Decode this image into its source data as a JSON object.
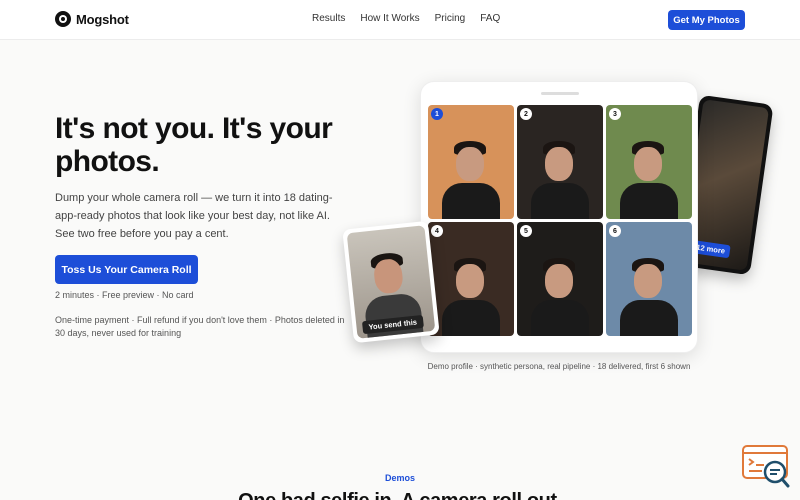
{
  "nav": {
    "brand": "Mogshot",
    "links": [
      "Results",
      "How It Works",
      "Pricing",
      "FAQ"
    ],
    "cta": "Get My Photos"
  },
  "hero": {
    "title": "It's not you. It's your photos.",
    "subtitle": "Dump your whole camera roll — we turn it into 18 dating-app-ready photos that look like your best day, not like AI. See two free before you pay a cent.",
    "cta": "Toss Us Your Camera Roll",
    "meta": "2 minutes · Free preview · No card",
    "guarantee": "One-time payment · Full refund if you don't love them · Photos deleted in 30 days, never used for training"
  },
  "showcase": {
    "photos": [
      {
        "badge": "1",
        "active": true,
        "bg": "#d7925a"
      },
      {
        "badge": "2",
        "active": false,
        "bg": "#2a2522"
      },
      {
        "badge": "3",
        "active": false,
        "bg": "#6f8a4e"
      },
      {
        "badge": "4",
        "active": false,
        "bg": "#3a2b23"
      },
      {
        "badge": "5",
        "active": false,
        "bg": "#1e1c1a"
      },
      {
        "badge": "6",
        "active": false,
        "bg": "#6d8aa8"
      }
    ],
    "front_label": "You send this",
    "more_label": "+12 more",
    "caption": "Demo profile · synthetic persona, real pipeline · 18 delivered, first 6 shown"
  },
  "demos": {
    "tag": "Demos",
    "title": "One bad selfie in. A camera roll out."
  },
  "colors": {
    "accent": "#1d4ed8",
    "background": "#fafaf9"
  }
}
